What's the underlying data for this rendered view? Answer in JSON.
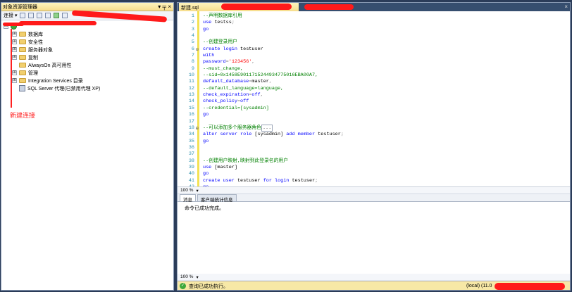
{
  "object_explorer": {
    "title": "对象资源管理器",
    "pin": "▾ ╤ ×",
    "connect_label": "连接 ▾",
    "tree": [
      {
        "label": "",
        "expander": "⊟",
        "selected": true
      },
      {
        "label": "数据库",
        "expander": "⊞"
      },
      {
        "label": "安全性",
        "expander": "⊞"
      },
      {
        "label": "服务器对象",
        "expander": "⊞"
      },
      {
        "label": "复制",
        "expander": "⊞"
      },
      {
        "label": "AlwaysOn 高可用性",
        "expander": ""
      },
      {
        "label": "管理",
        "expander": "⊞"
      },
      {
        "label": "Integration Services 目录",
        "expander": "⊞"
      },
      {
        "label": "SQL Server 代理(已禁用代理 XP)",
        "expander": ""
      }
    ],
    "annotation": "新建连接"
  },
  "editor": {
    "tab_title": "新建.sql",
    "lines": [
      {
        "n": "1",
        "parts": [
          [
            "cm",
            "--声明数据库引用"
          ]
        ]
      },
      {
        "n": "2",
        "parts": [
          [
            "kw",
            "use "
          ],
          [
            "",
            "testss"
          ],
          [
            "gy",
            ";"
          ]
        ]
      },
      {
        "n": "3",
        "parts": [
          [
            "kw",
            "go"
          ]
        ]
      },
      {
        "n": "4",
        "parts": []
      },
      {
        "n": "5",
        "parts": [
          [
            "cm",
            "--创建登录用户"
          ]
        ]
      },
      {
        "n": "6",
        "fold": "⊟",
        "parts": [
          [
            "kw",
            "create login "
          ],
          [
            "",
            "testuser"
          ]
        ]
      },
      {
        "n": "7",
        "parts": [
          [
            "kw",
            "with"
          ]
        ]
      },
      {
        "n": "8",
        "parts": [
          [
            "kw",
            "password"
          ],
          [
            "gy",
            "="
          ],
          [
            "st",
            "'123456'"
          ],
          [
            "gy",
            ","
          ]
        ]
      },
      {
        "n": "9",
        "parts": [
          [
            "cm",
            "--must_change,"
          ]
        ]
      },
      {
        "n": "10",
        "parts": [
          [
            "cm",
            "--sid=0x1458E9011715244934775016EBA00A7,"
          ]
        ]
      },
      {
        "n": "11",
        "parts": [
          [
            "kw",
            "default_database"
          ],
          [
            "gy",
            "="
          ],
          [
            "",
            "master"
          ],
          [
            "gy",
            ","
          ]
        ]
      },
      {
        "n": "12",
        "parts": [
          [
            "cm",
            "--default_language=language,"
          ]
        ]
      },
      {
        "n": "13",
        "parts": [
          [
            "kw",
            "check_expiration"
          ],
          [
            "gy",
            "="
          ],
          [
            "kw",
            "off"
          ],
          [
            "gy",
            ","
          ]
        ]
      },
      {
        "n": "14",
        "parts": [
          [
            "kw",
            "check_policy"
          ],
          [
            "gy",
            "="
          ],
          [
            "kw",
            "off"
          ]
        ]
      },
      {
        "n": "15",
        "parts": [
          [
            "cm",
            "--credential=[sysadmin]"
          ]
        ]
      },
      {
        "n": "16",
        "parts": [
          [
            "kw",
            "go"
          ]
        ]
      },
      {
        "n": "17",
        "parts": []
      },
      {
        "n": "18",
        "fold": "⊞",
        "parts": [
          [
            "cm",
            "--可以添加多个服务器角色"
          ],
          [
            "box",
            "..."
          ]
        ]
      },
      {
        "n": "34",
        "parts": [
          [
            "kw",
            "alter server role "
          ],
          [
            "",
            "[sysadmin] "
          ],
          [
            "kw",
            "add member "
          ],
          [
            "",
            "testuser"
          ],
          [
            "gy",
            ";"
          ]
        ]
      },
      {
        "n": "35",
        "parts": [
          [
            "kw",
            "go"
          ]
        ]
      },
      {
        "n": "36",
        "parts": []
      },
      {
        "n": "37",
        "parts": []
      },
      {
        "n": "38",
        "parts": [
          [
            "cm",
            "--创建用户映射,映射到此登录名的用户"
          ]
        ]
      },
      {
        "n": "39",
        "parts": [
          [
            "kw",
            "use "
          ],
          [
            "",
            "[master]"
          ]
        ]
      },
      {
        "n": "40",
        "parts": [
          [
            "kw",
            "go"
          ]
        ]
      },
      {
        "n": "41",
        "parts": [
          [
            "kw",
            "create user "
          ],
          [
            "",
            "testuser "
          ],
          [
            "kw",
            "for login "
          ],
          [
            "",
            "testuser"
          ],
          [
            "gy",
            ";"
          ]
        ]
      },
      {
        "n": "42",
        "parts": [
          [
            "kw",
            "go"
          ]
        ]
      }
    ]
  },
  "zoom": {
    "label": "100 %",
    "dropdown": "▾"
  },
  "results": {
    "tabs": [
      {
        "label": "消息",
        "active": true
      },
      {
        "label": "客户端统计信息",
        "active": false
      }
    ],
    "message": "命令已成功完成。"
  },
  "status": {
    "text": "查询已成功执行。",
    "server": "(local) (11.0"
  }
}
